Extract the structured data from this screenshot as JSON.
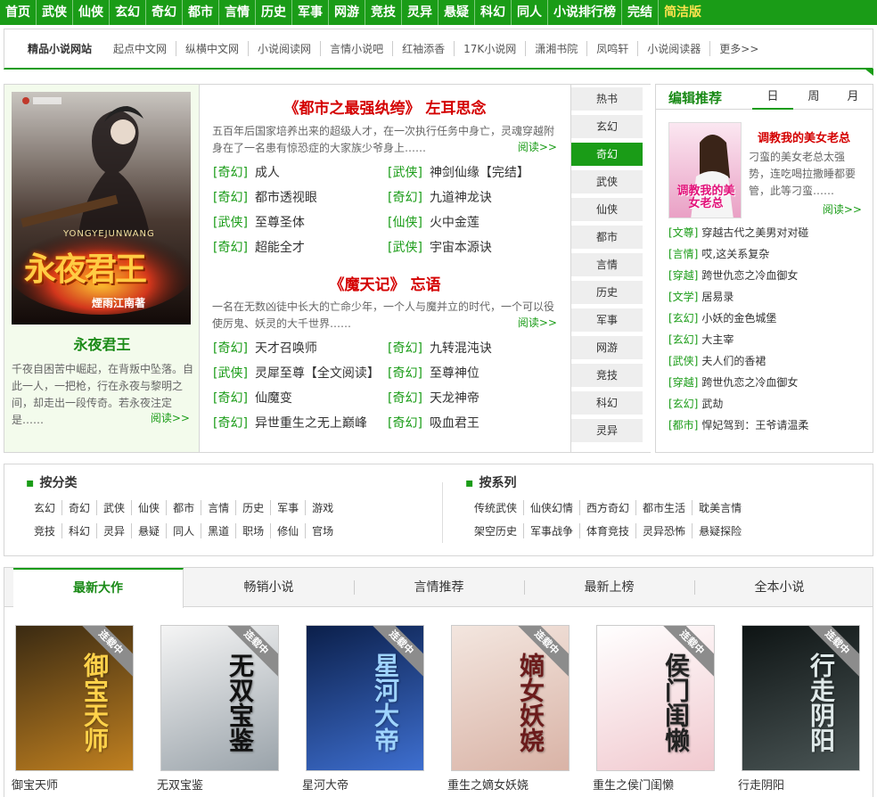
{
  "nav": {
    "items": [
      "首页",
      "武侠",
      "仙侠",
      "玄幻",
      "奇幻",
      "都市",
      "言情",
      "历史",
      "军事",
      "网游",
      "竞技",
      "灵异",
      "悬疑",
      "科幻",
      "同人",
      "小说排行榜",
      "完结"
    ],
    "simple": "简洁版"
  },
  "links_bar": {
    "title": "精品小说网站",
    "links": [
      "起点中文网",
      "纵横中文网",
      "小说阅读网",
      "言情小说吧",
      "红袖添香",
      "17K小说网",
      "潇湘书院",
      "凤鸣轩",
      "小说阅读器",
      "更多>>"
    ]
  },
  "featured": {
    "title": "永夜君王",
    "cover_title": "永夜君王",
    "cover_author": "煙雨江南",
    "cover_author_suffix": "著",
    "cover_en": "YONGYEJUNWANG",
    "desc": "千夜自困苦中崛起，在背叛中坠落。自此一人，一把枪，行在永夜与黎明之间，却走出一段传奇。若永夜注定是……",
    "more": "阅读>>"
  },
  "center": {
    "block1": {
      "title": "《都市之最强纨绔》 左耳思念",
      "desc": "五百年后国家培养出来的超级人才，在一次执行任务中身亡，灵魂穿越附身在了一名患有惊恐症的大家族少爷身上……",
      "more": "阅读>>",
      "list": [
        {
          "cat": "[奇幻]",
          "name": "成人"
        },
        {
          "cat": "[武侠]",
          "name": "神剑仙缘【完结】"
        },
        {
          "cat": "[奇幻]",
          "name": "都市透视眼"
        },
        {
          "cat": "[奇幻]",
          "name": "九道神龙诀"
        },
        {
          "cat": "[武侠]",
          "name": "至尊圣体"
        },
        {
          "cat": "[仙侠]",
          "name": "火中金莲"
        },
        {
          "cat": "[奇幻]",
          "name": "超能全才"
        },
        {
          "cat": "[武侠]",
          "name": "宇宙本源诀"
        }
      ]
    },
    "block2": {
      "title": "《魔天记》 忘语",
      "desc": "一名在无数凶徒中长大的亡命少年，一个人与魔并立的时代，一个可以役使厉鬼、妖灵的大千世界……",
      "more": "阅读>>",
      "list": [
        {
          "cat": "[奇幻]",
          "name": "天才召唤师"
        },
        {
          "cat": "[奇幻]",
          "name": "九转混沌诀"
        },
        {
          "cat": "[武侠]",
          "name": "灵犀至尊【全文阅读】"
        },
        {
          "cat": "[奇幻]",
          "name": "至尊神位"
        },
        {
          "cat": "[奇幻]",
          "name": "仙魔变"
        },
        {
          "cat": "[奇幻]",
          "name": "天龙神帝"
        },
        {
          "cat": "[奇幻]",
          "name": "异世重生之无上巅峰"
        },
        {
          "cat": "[奇幻]",
          "name": "吸血君王"
        }
      ]
    }
  },
  "category_tabs": {
    "items": [
      "热书",
      "玄幻",
      "奇幻",
      "武侠",
      "仙侠",
      "都市",
      "言情",
      "历史",
      "军事",
      "网游",
      "竞技",
      "科幻",
      "灵异"
    ],
    "active": "奇幻"
  },
  "editor": {
    "title": "编辑推荐",
    "tabs": [
      "日",
      "周",
      "月"
    ],
    "book_title": "调教我的美女老总",
    "cover_text": "调教我的美女老总",
    "book_desc": "刁蛮的美女老总太强势，连吃喝拉撒睡都要管，此等刁蛮……",
    "more": "阅读>>",
    "list": [
      {
        "cat": "[文尊]",
        "name": "穿越古代之美男对对碰"
      },
      {
        "cat": "[言情]",
        "name": "哎,这关系复杂"
      },
      {
        "cat": "[穿越]",
        "name": "跨世仇恋之冷血御女"
      },
      {
        "cat": "[文学]",
        "name": "居易录"
      },
      {
        "cat": "[玄幻]",
        "name": "小妖的金色城堡"
      },
      {
        "cat": "[玄幻]",
        "name": "大主宰"
      },
      {
        "cat": "[武侠]",
        "name": "夫人们的香裙"
      },
      {
        "cat": "[穿越]",
        "name": "跨世仇恋之冷血御女"
      },
      {
        "cat": "[玄幻]",
        "name": "武劫"
      },
      {
        "cat": "[都市]",
        "name": "悍妃驾到：王爷请温柔"
      }
    ]
  },
  "classify": {
    "by_category": {
      "title": "按分类",
      "row1": [
        "玄幻",
        "奇幻",
        "武侠",
        "仙侠",
        "都市",
        "言情",
        "历史",
        "军事",
        "游戏"
      ],
      "row2": [
        "竞技",
        "科幻",
        "灵异",
        "悬疑",
        "同人",
        "黑道",
        "职场",
        "修仙",
        "官场"
      ]
    },
    "by_series": {
      "title": "按系列",
      "row1": [
        "传统武侠",
        "仙侠幻情",
        "西方奇幻",
        "都市生活",
        "耽美言情"
      ],
      "row2": [
        "架空历史",
        "军事战争",
        "体育竞技",
        "灵异恐怖",
        "悬疑探险"
      ]
    }
  },
  "bottom_tabs": {
    "items": [
      "最新大作",
      "畅销小说",
      "言情推荐",
      "最新上榜",
      "全本小说"
    ],
    "active": "最新大作"
  },
  "books": [
    {
      "title": "御宝天师",
      "cover_text": "御宝天师",
      "ribbon": "连载中",
      "bg1": "#3a2a12",
      "bg2": "#c08020",
      "fg": "#ffd24a"
    },
    {
      "title": "无双宝鉴",
      "cover_text": "无双宝鉴",
      "ribbon": "连载中",
      "bg1": "#f5f5f5",
      "bg2": "#9aa3aa",
      "fg": "#111111"
    },
    {
      "title": "星河大帝",
      "cover_text": "星河大帝",
      "ribbon": "连载中",
      "bg1": "#0b1f4a",
      "bg2": "#3e6fd0",
      "fg": "#9fd4ff"
    },
    {
      "title": "重生之嫡女妖娆",
      "cover_text": "嫡女妖娆",
      "ribbon": "连载中",
      "bg1": "#f3e6df",
      "bg2": "#d9b3a6",
      "fg": "#6b1b1b"
    },
    {
      "title": "重生之侯门闺懒",
      "cover_text": "侯门闺懒",
      "ribbon": "连载中",
      "bg1": "#ffffff",
      "bg2": "#f1c9cf",
      "fg": "#222222"
    },
    {
      "title": "行走阴阳",
      "cover_text": "行走阴阳",
      "ribbon": "连载中",
      "bg1": "#0e1414",
      "bg2": "#4a5555",
      "fg": "#dfe9e9"
    }
  ],
  "colors": {
    "brand_green": "#1a9c17",
    "title_red": "#d40000"
  }
}
